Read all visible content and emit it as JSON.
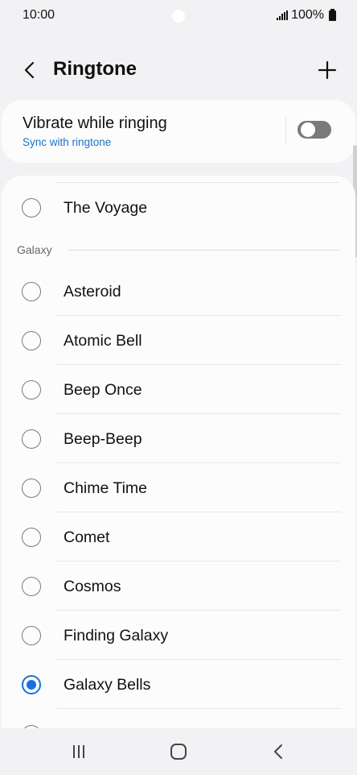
{
  "status_bar": {
    "time": "10:00",
    "battery": "100%"
  },
  "header": {
    "title": "Ringtone"
  },
  "vibrate": {
    "title": "Vibrate while ringing",
    "subtitle": "Sync with ringtone",
    "enabled": false
  },
  "list": {
    "above_items": [
      {
        "label": "The Voyage",
        "selected": false
      }
    ],
    "section_label": "Galaxy",
    "items": [
      {
        "label": "Asteroid",
        "selected": false
      },
      {
        "label": "Atomic Bell",
        "selected": false
      },
      {
        "label": "Beep Once",
        "selected": false
      },
      {
        "label": "Beep-Beep",
        "selected": false
      },
      {
        "label": "Chime Time",
        "selected": false
      },
      {
        "label": "Comet",
        "selected": false
      },
      {
        "label": "Cosmos",
        "selected": false
      },
      {
        "label": "Finding Galaxy",
        "selected": false
      },
      {
        "label": "Galaxy Bells",
        "selected": true
      }
    ]
  },
  "colors": {
    "accent": "#1a6ee4",
    "link": "#1a73c9",
    "background": "#f2f2f4",
    "card": "#fcfcfc"
  },
  "icons": {
    "back": "chevron-left-icon",
    "add": "plus-icon",
    "signal": "signal-icon",
    "battery": "battery-icon",
    "nav_recents": "recents-icon",
    "nav_home": "home-icon",
    "nav_back": "back-icon"
  }
}
